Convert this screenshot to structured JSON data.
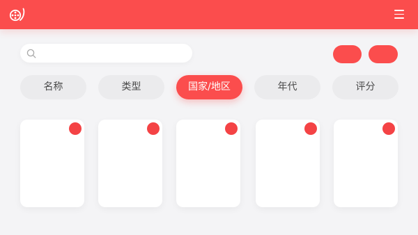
{
  "colors": {
    "accent": "#fb4d4d",
    "background": "#f4f4f6",
    "tab_inactive_bg": "#ebebed",
    "card_bg": "#ffffff",
    "badge_dot": "#f44345"
  },
  "header": {
    "logo_icon": "film-reel-logo-icon",
    "menu_icon": "hamburger-menu-icon"
  },
  "search": {
    "icon": "search-icon",
    "placeholder": ""
  },
  "filters": {
    "tabs": [
      {
        "label": "名称",
        "active": false
      },
      {
        "label": "类型",
        "active": false
      },
      {
        "label": "国家/地区",
        "active": true
      },
      {
        "label": "年代",
        "active": false
      },
      {
        "label": "评分",
        "active": false
      }
    ]
  },
  "cards": [
    {
      "badge": "red-dot"
    },
    {
      "badge": "red-dot"
    },
    {
      "badge": "red-dot"
    },
    {
      "badge": "red-dot"
    },
    {
      "badge": "red-dot"
    }
  ]
}
